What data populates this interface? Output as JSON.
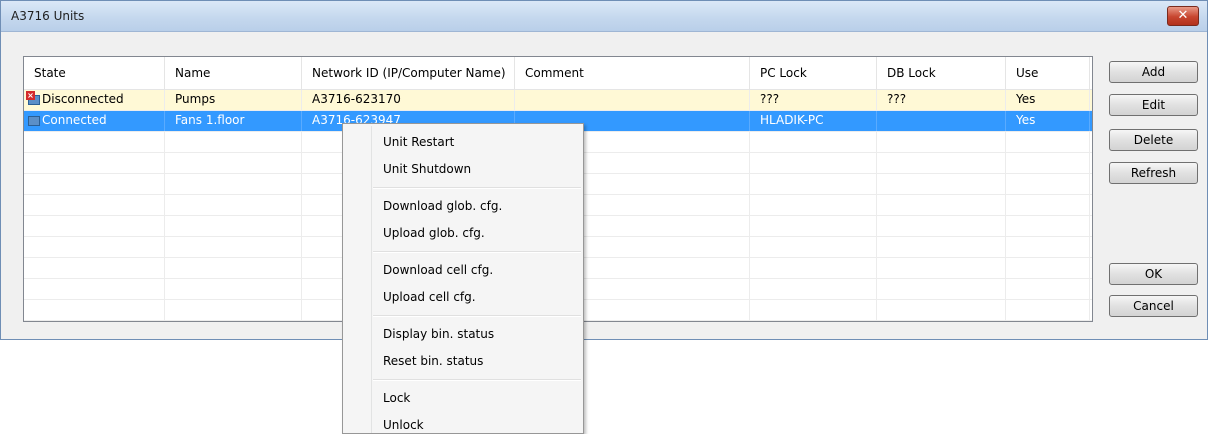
{
  "window": {
    "title": "A3716 Units",
    "close_glyph": "✕"
  },
  "table": {
    "columns": [
      "State",
      "Name",
      "Network ID (IP/Computer Name)",
      "Comment",
      "PC Lock",
      "DB Lock",
      "Use"
    ],
    "rows": [
      {
        "state": "Disconnected",
        "state_icon": "disconnected-pc-icon",
        "name": "Pumps",
        "network_id": "A3716-623170",
        "comment": "",
        "pc_lock": "???",
        "db_lock": "???",
        "use": "Yes"
      },
      {
        "state": "Connected",
        "state_icon": "connected-pc-icon",
        "name": "Fans 1.floor",
        "network_id": "A3716-623947",
        "comment": "",
        "pc_lock": "HLADIK-PC",
        "db_lock": "",
        "use": "Yes"
      }
    ]
  },
  "buttons": {
    "add": "Add",
    "edit": "Edit",
    "delete": "Delete",
    "refresh": "Refresh",
    "ok": "OK",
    "cancel": "Cancel"
  },
  "context_menu": {
    "items": [
      "Unit Restart",
      "Unit Shutdown",
      "Download glob. cfg.",
      "Upload glob. cfg.",
      "Download cell cfg.",
      "Upload cell cfg.",
      "Display bin. status",
      "Reset bin. status",
      "Lock",
      "Unlock"
    ]
  },
  "colors": {
    "selection": "#3399ff",
    "disconnected_row": "#fff9d6",
    "dialog_bg": "#f0f0f0"
  }
}
